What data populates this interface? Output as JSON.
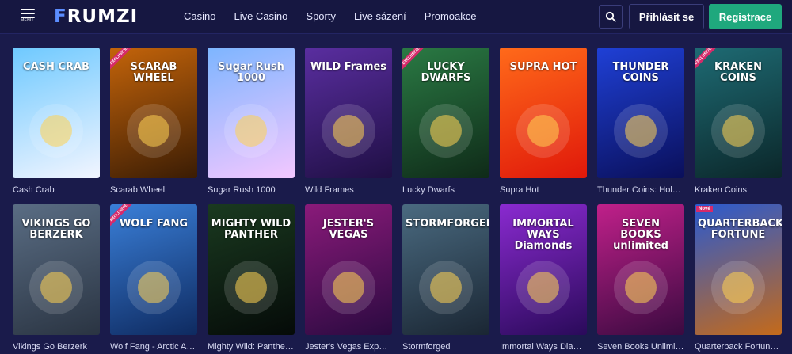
{
  "header": {
    "menu_label": "MENU",
    "logo_first": "F",
    "logo_rest": "RUMZI",
    "nav": [
      "Casino",
      "Live Casino",
      "Sporty",
      "Live sázení",
      "Promoakce"
    ],
    "login_label": "Přihlásit se",
    "register_label": "Registrace",
    "accent_color": "#1fa87d",
    "logo_color": "#5b8dff"
  },
  "games": [
    {
      "name": "Cash Crab",
      "art_title": "CASH CRAB",
      "badge": "",
      "colors": [
        "#6ec9ff",
        "#f2f5ff"
      ]
    },
    {
      "name": "Scarab Wheel",
      "art_title": "SCARAB WHEEL",
      "badge": "EXCLUSIVE",
      "colors": [
        "#c4640a",
        "#3a1c04"
      ]
    },
    {
      "name": "Sugar Rush 1000",
      "art_title": "Sugar Rush 1000",
      "badge": "",
      "colors": [
        "#7db5ff",
        "#f3c7ff"
      ]
    },
    {
      "name": "Wild Frames",
      "art_title": "WILD Frames",
      "badge": "",
      "colors": [
        "#5a2ea0",
        "#1f0f44"
      ]
    },
    {
      "name": "Lucky Dwarfs",
      "art_title": "LUCKY DWARFS",
      "badge": "EXCLUSIVE",
      "colors": [
        "#2a7a44",
        "#0f2a18"
      ]
    },
    {
      "name": "Supra Hot",
      "art_title": "SUPRA HOT",
      "badge": "",
      "colors": [
        "#ff6a1a",
        "#e0180a"
      ]
    },
    {
      "name": "Thunder Coins: Hold and Win",
      "art_title": "THUNDER COINS",
      "badge": "",
      "colors": [
        "#1f40d6",
        "#0a0f5a"
      ]
    },
    {
      "name": "Kraken Coins",
      "art_title": "KRAKEN COINS",
      "badge": "EXCLUSIVE",
      "colors": [
        "#1e6b74",
        "#0b2629"
      ]
    },
    {
      "name": "Vikings Go Berzerk",
      "art_title": "VIKINGS GO BERZERK",
      "badge": "",
      "colors": [
        "#5a6d84",
        "#2a3442"
      ]
    },
    {
      "name": "Wolf Fang - Arctic Adventures",
      "art_title": "WOLF FANG",
      "badge": "EXCLUSIVE",
      "colors": [
        "#3a7fd8",
        "#0e2a60"
      ]
    },
    {
      "name": "Mighty Wild: Panther Grand Diamond Edition",
      "art_title": "MIGHTY WILD PANTHER",
      "badge": "",
      "colors": [
        "#1a3a20",
        "#050a08"
      ]
    },
    {
      "name": "Jester's Vegas Experience",
      "art_title": "JESTER'S VEGAS",
      "badge": "",
      "colors": [
        "#8a1a7a",
        "#2a0a40"
      ]
    },
    {
      "name": "Stormforged",
      "art_title": "STORMFORGED",
      "badge": "",
      "colors": [
        "#4a6a80",
        "#1a2633"
      ]
    },
    {
      "name": "Immortal Ways Diamonds",
      "art_title": "IMMORTAL WAYS Diamonds",
      "badge": "",
      "colors": [
        "#8a2ad0",
        "#2a0a5a"
      ]
    },
    {
      "name": "Seven Books Unlimited",
      "art_title": "SEVEN BOOKS unlimited",
      "badge": "",
      "colors": [
        "#c0208a",
        "#3a0a40"
      ]
    },
    {
      "name": "Quarterback Fortune Hold and Win",
      "art_title": "QUARTERBACK FORTUNE",
      "badge": "Nové",
      "colors": [
        "#2a5ad0",
        "#c46a1a"
      ]
    }
  ]
}
